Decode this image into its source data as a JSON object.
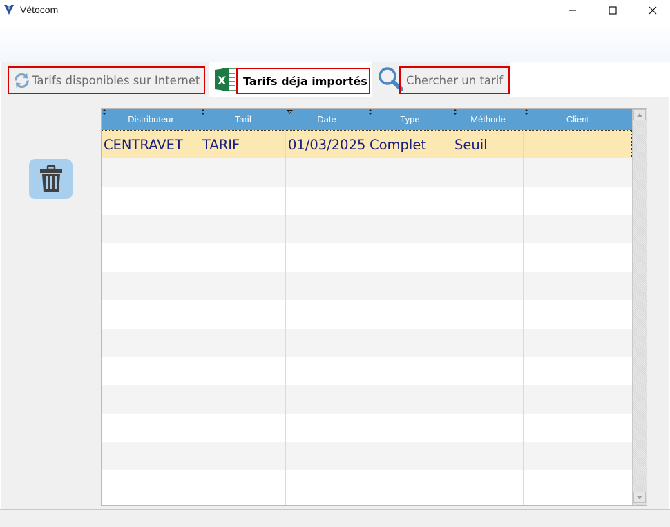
{
  "window": {
    "title": "Vétocom"
  },
  "tabs": [
    {
      "label": "Tarifs disponibles sur Internet",
      "icon": "refresh-icon",
      "active": false
    },
    {
      "label": "Tarifs déja importés",
      "icon": "excel-icon",
      "active": true
    },
    {
      "label": "Chercher un tarif",
      "icon": "search-icon",
      "active": false
    }
  ],
  "toolbar": {
    "delete_icon": "trash-icon"
  },
  "table": {
    "columns": [
      "Distributeur",
      "Tarif",
      "Date",
      "Type",
      "Méthode",
      "Client"
    ],
    "rows": [
      [
        "CENTRAVET",
        "TARIF",
        "01/03/2025",
        "Complet",
        "Seuil",
        ""
      ]
    ]
  },
  "colors": {
    "header_blue": "#5aa0d2",
    "selected_row": "#fce8b2",
    "cell_text": "#1a2080",
    "highlight_border": "#d80000",
    "trash_button": "#a9cfee"
  }
}
